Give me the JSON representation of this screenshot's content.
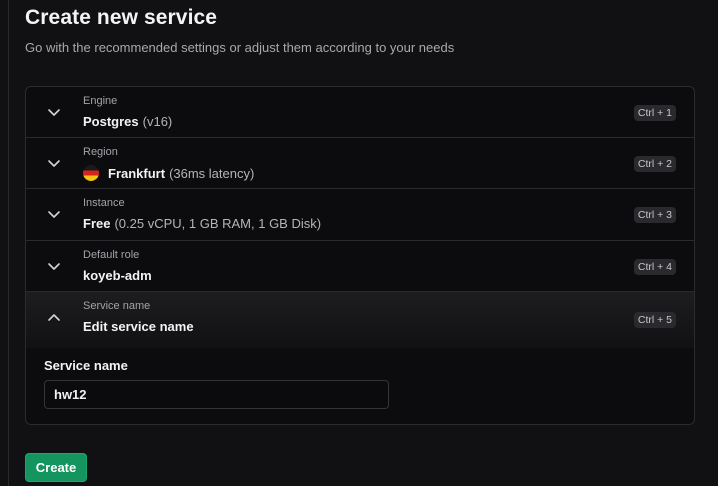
{
  "header": {
    "title": "Create new service",
    "subtitle": "Go with the recommended settings or adjust them according to your needs"
  },
  "sections": [
    {
      "label": "Engine",
      "value": "Postgres",
      "detail": "(v16)",
      "shortcut": "Ctrl + 1",
      "expanded": false
    },
    {
      "label": "Region",
      "value": "Frankfurt",
      "detail": "(36ms latency)",
      "shortcut": "Ctrl + 2",
      "expanded": false,
      "icon": "germany-flag-icon"
    },
    {
      "label": "Instance",
      "value": "Free",
      "detail": "(0.25 vCPU, 1 GB RAM, 1 GB Disk)",
      "shortcut": "Ctrl + 3",
      "expanded": false
    },
    {
      "label": "Default role",
      "value": "koyeb-adm",
      "detail": "",
      "shortcut": "Ctrl + 4",
      "expanded": false
    },
    {
      "label": "Service name",
      "value": "Edit service name",
      "detail": "",
      "shortcut": "Ctrl + 5",
      "expanded": true
    }
  ],
  "service_name_field": {
    "label": "Service name",
    "value": "hw12"
  },
  "actions": {
    "create_label": "Create"
  },
  "colors": {
    "accent": "#14955f",
    "background": "#111113",
    "card": "#0c0c0e"
  }
}
